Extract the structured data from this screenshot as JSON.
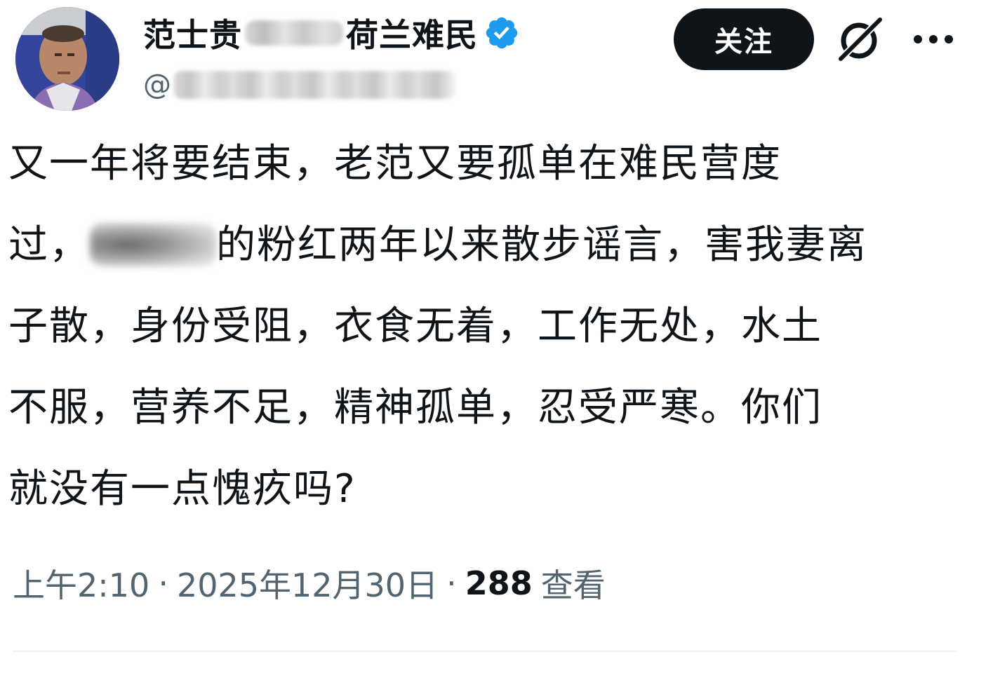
{
  "author": {
    "name_prefix": "范士贵",
    "name_suffix": "荷兰难民",
    "verified_icon": "verified-badge-icon",
    "handle_at": "@"
  },
  "actions": {
    "follow_label": "关注",
    "grok_icon": "grok-slash-icon",
    "more_icon": "more-dots-icon"
  },
  "tweet": {
    "line1": "又一年将要结束，老范又要孤单在难民营度",
    "line2_prefix": "过，",
    "line2_suffix": "的粉红两年以来散步谣言，害我妻离",
    "line3": "子散，身份受阻，衣食无着，工作无处，水土",
    "line4": "不服，营养不足，精神孤单，忍受严寒。你们",
    "line5": "就没有一点愧疚吗?"
  },
  "meta": {
    "time": "上午2:10",
    "separator": "·",
    "date": "2025年12月30日",
    "views_count": "288",
    "views_label": "查看"
  },
  "colors": {
    "text_primary": "#0f1419",
    "text_secondary": "#536471",
    "verified_blue": "#1d9bf0",
    "button_bg": "#0f1419"
  }
}
